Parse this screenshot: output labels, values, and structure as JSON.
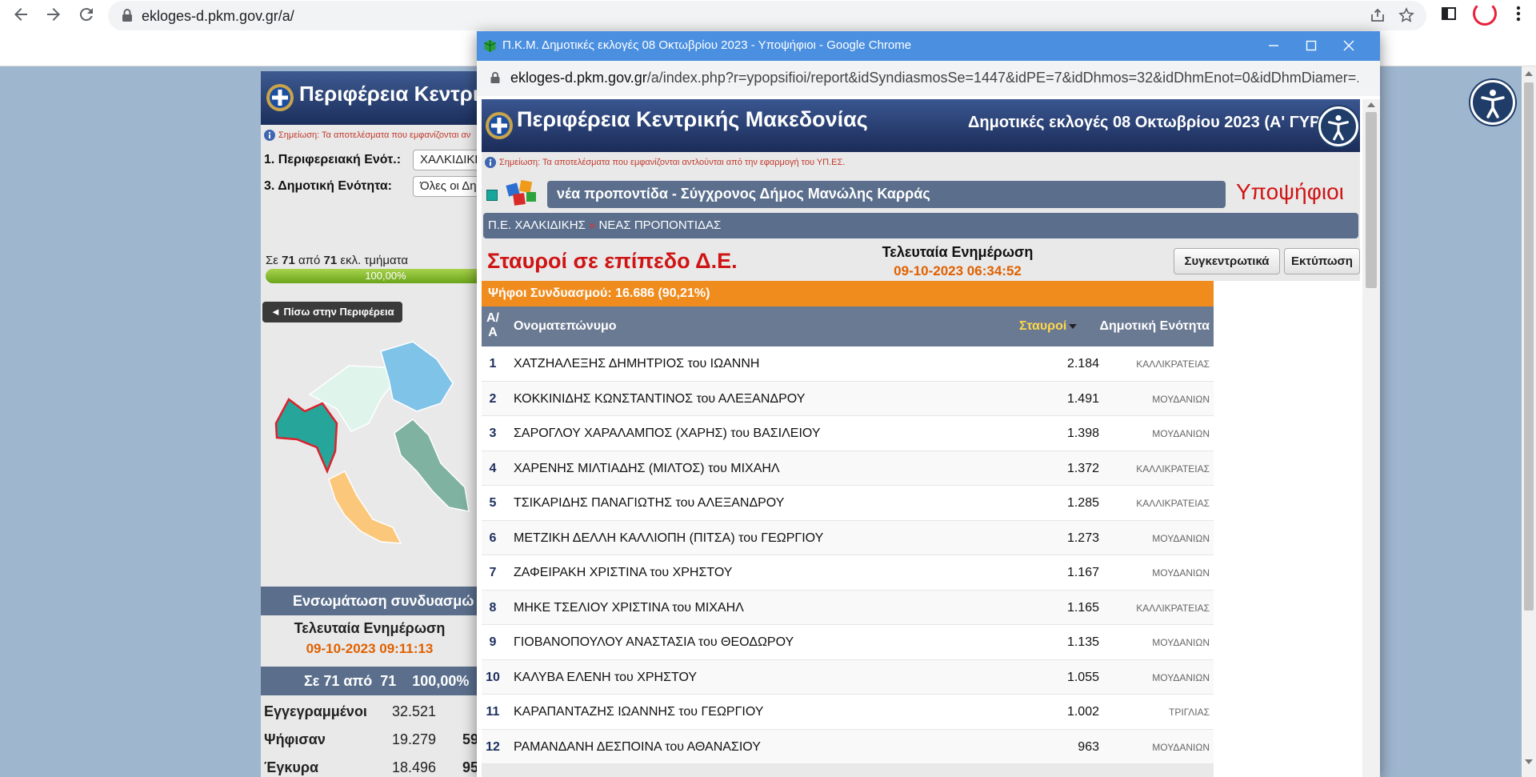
{
  "browser": {
    "url": "ekloges-d.pkm.gov.gr/a/"
  },
  "bg": {
    "header_title": "Περιφέρεια Κεντρικ",
    "note": "Σημείωση: Τα αποτελέσματα που εμφανίζονται αν",
    "label_region": "1. Περιφερειακή Ενότ.:",
    "region_value": "ΧΑΛΚΙΔΙΚΗΣ",
    "label_unit": "3. Δημοτική Ενότητα:",
    "unit_value": "Όλες οι Δημ",
    "progress_prefix": "Σε",
    "progress_a": "71",
    "progress_mid": "από",
    "progress_b": "71",
    "progress_suffix": "εκλ. τμήματα",
    "progress_pct_text": "100,00%",
    "progress_fraction": 1.0,
    "back_button": "◄ Πίσω στην Περιφέρεια",
    "integration_title": "Ενσωμάτωση συνδυασμώ",
    "last_update_label": "Τελευταία Ενημέρωση",
    "last_update_value": "09-10-2023 09:11:13",
    "summary_a": "Σε 71 από",
    "summary_b": "71",
    "summary_c": "100,00%",
    "stats": [
      {
        "label": "Εγγεγραμμένοι",
        "value": "32.521",
        "extra": ""
      },
      {
        "label": "Ψήφισαν",
        "value": "19.279",
        "extra": "59"
      },
      {
        "label": "Έγκυρα",
        "value": "18.496",
        "extra": "95"
      }
    ]
  },
  "popup": {
    "title": "Π.Κ.Μ. Δημοτικές εκλογές 08 Οκτωβρίου 2023 - Υποψήφιοι - Google Chrome",
    "url_domain": "ekloges-d.pkm.gov.gr",
    "url_path": "/a/index.php?r=ypopsifioi/report&idSyndiasmosSe=1447&idPE=7&idDhmos=32&idDhmEnot=0&idDhmDiamer=...",
    "header_title": "Περιφέρεια Κεντρικής Μακεδονίας",
    "header_right": "Δημοτικές εκλογές 08 Οκτωβρίου 2023 (Α' ΓΥΡ",
    "note": "Σημείωση: Τα αποτελέσματα που εμφανίζονται αντλούνται από την εφαρμογή του ΥΠ.ΕΣ.",
    "party": "νέα προποντίδα - Σύγχρονος Δήμος Μανώλης Καρράς",
    "candidates_label": "Υποψήφιοι",
    "crumb_a": "Π.Ε. ΧΑΛΚΙΔΙΚΗΣ",
    "crumb_sep": "»",
    "crumb_b": "ΝΕΑΣ ΠΡΟΠΟΝΤΙΔΑΣ",
    "section_title": "Σταυροί σε επίπεδο Δ.Ε.",
    "update_label": "Τελευταία Ενημέρωση",
    "update_value": "09-10-2023 06:34:52",
    "btn_summary": "Συγκεντρωτικά",
    "btn_print": "Εκτύπωση",
    "votes_bar": "Ψήφοι Συνδυασμού: 16.686 (90,21%)",
    "col_aa_1": "Α/",
    "col_aa_2": "Α",
    "col_name": "Ονοματεπώνυμο",
    "col_votes": "Σταυροί",
    "col_unit": "Δημοτική Ενότητα",
    "rows": [
      {
        "n": "1",
        "name": "ΧΑΤΖΗΑΛΕΞΗΣ ΔΗΜΗΤΡΙΟΣ του ΙΩΑΝΝΗ",
        "votes": "2.184",
        "unit": "ΚΑΛΛΙΚΡΑΤΕΙΑΣ"
      },
      {
        "n": "2",
        "name": "ΚΟΚΚΙΝΙΔΗΣ ΚΩΝΣΤΑΝΤΙΝΟΣ του ΑΛΕΞΑΝΔΡΟΥ",
        "votes": "1.491",
        "unit": "ΜΟΥΔΑΝΙΩΝ"
      },
      {
        "n": "3",
        "name": "ΣΑΡΟΓΛΟΥ ΧΑΡΑΛΑΜΠΟΣ (ΧΑΡΗΣ) του ΒΑΣΙΛΕΙΟΥ",
        "votes": "1.398",
        "unit": "ΜΟΥΔΑΝΙΩΝ"
      },
      {
        "n": "4",
        "name": "ΧΑΡΕΝΗΣ ΜΙΛΤΙΑΔΗΣ (ΜΙΛΤΟΣ) του ΜΙΧΑΗΛ",
        "votes": "1.372",
        "unit": "ΚΑΛΛΙΚΡΑΤΕΙΑΣ"
      },
      {
        "n": "5",
        "name": "ΤΣΙΚΑΡΙΔΗΣ ΠΑΝΑΓΙΩΤΗΣ του ΑΛΕΞΑΝΔΡΟΥ",
        "votes": "1.285",
        "unit": "ΚΑΛΛΙΚΡΑΤΕΙΑΣ"
      },
      {
        "n": "6",
        "name": "ΜΕΤΖΙΚΗ ΔΕΛΛΗ ΚΑΛΛΙΟΠΗ (ΠΙΤΣΑ) του ΓΕΩΡΓΙΟΥ",
        "votes": "1.273",
        "unit": "ΜΟΥΔΑΝΙΩΝ"
      },
      {
        "n": "7",
        "name": "ΖΑΦΕΙΡΑΚΗ ΧΡΙΣΤΙΝΑ του ΧΡΗΣΤΟΥ",
        "votes": "1.167",
        "unit": "ΜΟΥΔΑΝΙΩΝ"
      },
      {
        "n": "8",
        "name": "ΜΗΚΕ ΤΣΕΛΙΟΥ ΧΡΙΣΤΙΝΑ του ΜΙΧΑΗΛ",
        "votes": "1.165",
        "unit": "ΚΑΛΛΙΚΡΑΤΕΙΑΣ"
      },
      {
        "n": "9",
        "name": "ΓΙΟΒΑΝΟΠΟΥΛΟΥ ΑΝΑΣΤΑΣΙΑ του ΘΕΟΔΩΡΟΥ",
        "votes": "1.135",
        "unit": "ΜΟΥΔΑΝΙΩΝ"
      },
      {
        "n": "10",
        "name": "ΚΑΛΥΒΑ ΕΛΕΝΗ του ΧΡΗΣΤΟΥ",
        "votes": "1.055",
        "unit": "ΜΟΥΔΑΝΙΩΝ"
      },
      {
        "n": "11",
        "name": "ΚΑΡΑΠΑΝΤΑΖΗΣ ΙΩΑΝΝΗΣ του ΓΕΩΡΓΙΟΥ",
        "votes": "1.002",
        "unit": "ΤΡΙΓΛΙΑΣ"
      },
      {
        "n": "12",
        "name": "ΡΑΜΑΝΔΑΝΗ ΔΕΣΠΟΙΝΑ του ΑΘΑΝΑΣΙΟΥ",
        "votes": "963",
        "unit": "ΜΟΥΔΑΝΙΩΝ"
      }
    ]
  },
  "colors": {
    "accent_red": "#d01414",
    "accent_orange": "#f08c1e",
    "header_blue": "#1b2c58",
    "band_gray_blue": "#5b6f8d"
  }
}
